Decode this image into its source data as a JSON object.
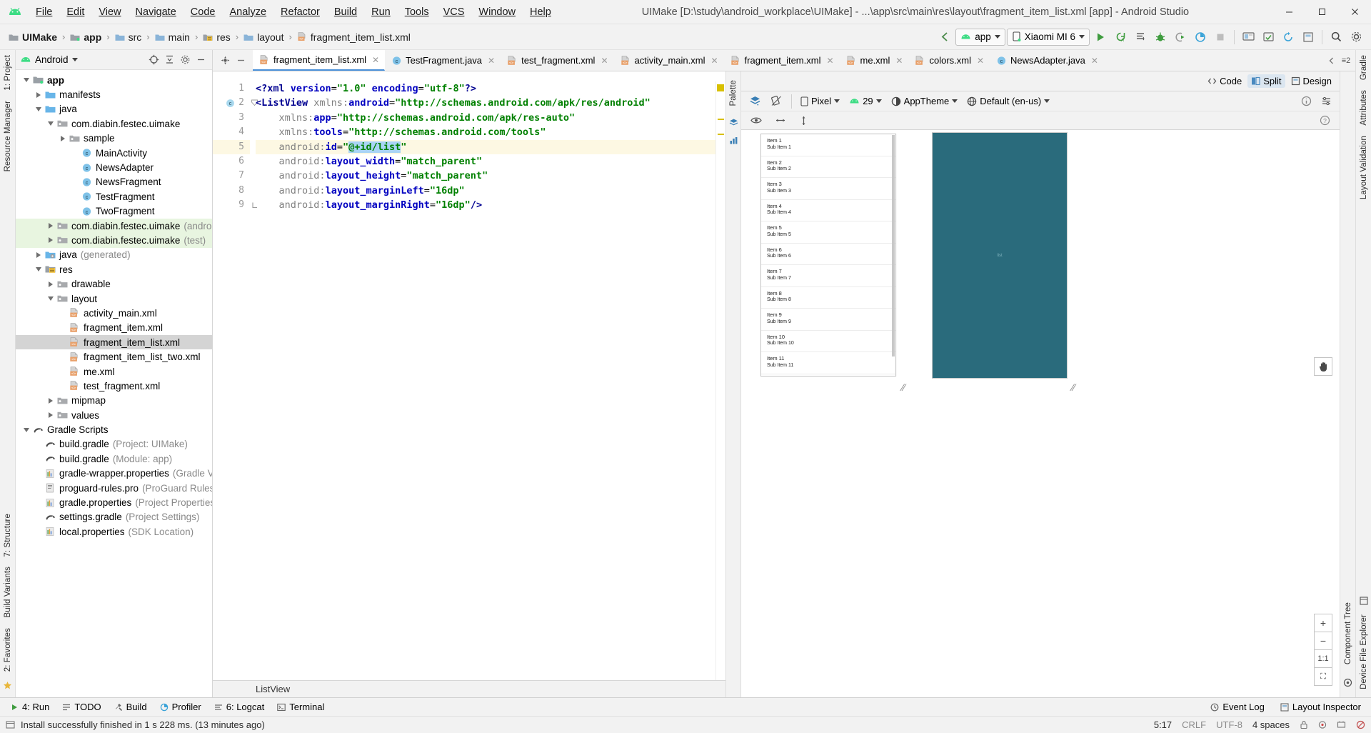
{
  "window": {
    "title": "UIMake [D:\\study\\android_workplace\\UIMake] - ...\\app\\src\\main\\res\\layout\\fragment_item_list.xml [app] - Android Studio",
    "minimize": "–",
    "maximize": "❐",
    "close": "✕"
  },
  "menu": [
    {
      "label": "File"
    },
    {
      "label": "Edit"
    },
    {
      "label": "View"
    },
    {
      "label": "Navigate"
    },
    {
      "label": "Code"
    },
    {
      "label": "Analyze"
    },
    {
      "label": "Refactor"
    },
    {
      "label": "Build"
    },
    {
      "label": "Run"
    },
    {
      "label": "Tools"
    },
    {
      "label": "VCS"
    },
    {
      "label": "Window"
    },
    {
      "label": "Help"
    }
  ],
  "breadcrumb": [
    {
      "label": "UIMake",
      "icon": "project-folder-icon"
    },
    {
      "label": "app",
      "icon": "module-folder-icon"
    },
    {
      "label": "src",
      "icon": "folder-icon"
    },
    {
      "label": "main",
      "icon": "folder-icon"
    },
    {
      "label": "res",
      "icon": "res-folder-icon"
    },
    {
      "label": "layout",
      "icon": "folder-icon"
    },
    {
      "label": "fragment_item_list.xml",
      "icon": "xml-file-icon"
    }
  ],
  "toolbar": {
    "run_config": "app",
    "device": "Xiaomi MI 6",
    "icons": [
      "back-arrow-icon",
      "run-icon",
      "apply-changes-icon",
      "apply-code-changes-icon",
      "debug-icon",
      "attach-debugger-icon",
      "profiler-icon",
      "stop-icon",
      "avd-manager-icon",
      "sdk-manager-icon",
      "sync-gradle-icon",
      "layout-inspector-icon",
      "search-icon"
    ]
  },
  "project_panel": {
    "view_selector": "Android",
    "header_icons": [
      "target-icon",
      "collapse-all-icon",
      "settings-gear-icon",
      "hide-icon"
    ],
    "tree": [
      {
        "label": "app",
        "indent": 0,
        "arrow": "open",
        "icon": "module-icon",
        "bold": true
      },
      {
        "label": "manifests",
        "indent": 1,
        "arrow": "closed",
        "icon": "folder-icon"
      },
      {
        "label": "java",
        "indent": 1,
        "arrow": "open",
        "icon": "folder-icon"
      },
      {
        "label": "com.diabin.festec.uimake",
        "indent": 2,
        "arrow": "open",
        "icon": "package-icon"
      },
      {
        "label": "sample",
        "indent": 3,
        "arrow": "closed",
        "icon": "package-icon"
      },
      {
        "label": "MainActivity",
        "indent": 4,
        "arrow": "none",
        "icon": "java-class-icon"
      },
      {
        "label": "NewsAdapter",
        "indent": 4,
        "arrow": "none",
        "icon": "java-class-icon"
      },
      {
        "label": "NewsFragment",
        "indent": 4,
        "arrow": "none",
        "icon": "java-class-icon"
      },
      {
        "label": "TestFragment",
        "indent": 4,
        "arrow": "none",
        "icon": "java-class-icon"
      },
      {
        "label": "TwoFragment",
        "indent": 4,
        "arrow": "none",
        "icon": "java-class-icon"
      },
      {
        "label": "com.diabin.festec.uimake",
        "sub": "(androidTest)",
        "indent": 2,
        "arrow": "closed",
        "icon": "package-icon",
        "green": true
      },
      {
        "label": "com.diabin.festec.uimake",
        "sub": "(test)",
        "indent": 2,
        "arrow": "closed",
        "icon": "package-icon",
        "green": true
      },
      {
        "label": "java",
        "sub": "(generated)",
        "indent": 1,
        "arrow": "closed",
        "icon": "generated-folder-icon"
      },
      {
        "label": "res",
        "indent": 1,
        "arrow": "open",
        "icon": "res-folder-icon"
      },
      {
        "label": "drawable",
        "indent": 2,
        "arrow": "closed",
        "icon": "package-icon"
      },
      {
        "label": "layout",
        "indent": 2,
        "arrow": "open",
        "icon": "package-icon"
      },
      {
        "label": "activity_main.xml",
        "indent": 3,
        "arrow": "none",
        "icon": "xml-file-icon"
      },
      {
        "label": "fragment_item.xml",
        "indent": 3,
        "arrow": "none",
        "icon": "xml-file-icon"
      },
      {
        "label": "fragment_item_list.xml",
        "indent": 3,
        "arrow": "none",
        "icon": "xml-file-icon",
        "selected": true
      },
      {
        "label": "fragment_item_list_two.xml",
        "indent": 3,
        "arrow": "none",
        "icon": "xml-file-icon"
      },
      {
        "label": "me.xml",
        "indent": 3,
        "arrow": "none",
        "icon": "xml-file-icon"
      },
      {
        "label": "test_fragment.xml",
        "indent": 3,
        "arrow": "none",
        "icon": "xml-file-icon"
      },
      {
        "label": "mipmap",
        "indent": 2,
        "arrow": "closed",
        "icon": "package-icon"
      },
      {
        "label": "values",
        "indent": 2,
        "arrow": "closed",
        "icon": "package-icon"
      },
      {
        "label": "Gradle Scripts",
        "indent": 0,
        "arrow": "open",
        "icon": "gradle-icon"
      },
      {
        "label": "build.gradle",
        "sub": "(Project: UIMake)",
        "indent": 1,
        "arrow": "none",
        "icon": "gradle-icon"
      },
      {
        "label": "build.gradle",
        "sub": "(Module: app)",
        "indent": 1,
        "arrow": "none",
        "icon": "gradle-icon"
      },
      {
        "label": "gradle-wrapper.properties",
        "sub": "(Gradle V",
        "indent": 1,
        "arrow": "none",
        "icon": "properties-icon"
      },
      {
        "label": "proguard-rules.pro",
        "sub": "(ProGuard Rules",
        "indent": 1,
        "arrow": "none",
        "icon": "proguard-icon"
      },
      {
        "label": "gradle.properties",
        "sub": "(Project Properties",
        "indent": 1,
        "arrow": "none",
        "icon": "properties-icon"
      },
      {
        "label": "settings.gradle",
        "sub": "(Project Settings)",
        "indent": 1,
        "arrow": "none",
        "icon": "gradle-icon"
      },
      {
        "label": "local.properties",
        "sub": "(SDK Location)",
        "indent": 1,
        "arrow": "none",
        "icon": "properties-icon"
      }
    ]
  },
  "editor_tabs": [
    {
      "label": "fragment_item_list.xml",
      "icon": "xml-file-icon",
      "active": true
    },
    {
      "label": "TestFragment.java",
      "icon": "java-class-icon",
      "active": false
    },
    {
      "label": "test_fragment.xml",
      "icon": "xml-file-icon",
      "active": false
    },
    {
      "label": "activity_main.xml",
      "icon": "xml-file-icon",
      "active": false
    },
    {
      "label": "fragment_item.xml",
      "icon": "xml-file-icon",
      "active": false
    },
    {
      "label": "me.xml",
      "icon": "xml-file-icon",
      "active": false
    },
    {
      "label": "colors.xml",
      "icon": "xml-file-icon",
      "active": false
    },
    {
      "label": "NewsAdapter.java",
      "icon": "java-class-icon",
      "active": false
    }
  ],
  "editor": {
    "line_count": 9,
    "lines": [
      {
        "n": "1",
        "text": "<?xml version=\"1.0\" encoding=\"utf-8\"?>"
      },
      {
        "n": "2",
        "text": "<ListView xmlns:android=\"http://schemas.android.com/apk/res/android\""
      },
      {
        "n": "3",
        "text": "    xmlns:app=\"http://schemas.android.com/apk/res-auto\""
      },
      {
        "n": "4",
        "text": "    xmlns:tools=\"http://schemas.android.com/tools\""
      },
      {
        "n": "5",
        "text": "    android:id=\"@+id/list\"",
        "highlighted": true
      },
      {
        "n": "6",
        "text": "    android:layout_width=\"match_parent\""
      },
      {
        "n": "7",
        "text": "    android:layout_height=\"match_parent\""
      },
      {
        "n": "8",
        "text": "    android:layout_marginLeft=\"16dp\""
      },
      {
        "n": "9",
        "text": "    android:layout_marginRight=\"16dp\"/>"
      }
    ],
    "selected_text": "@+id/list",
    "bottom_breadcrumb": "ListView"
  },
  "view_modes": [
    {
      "label": "Code",
      "icon": "code-view-icon",
      "active": false
    },
    {
      "label": "Split",
      "icon": "split-view-icon",
      "active": true
    },
    {
      "label": "Design",
      "icon": "design-view-icon",
      "active": false
    }
  ],
  "preview": {
    "toolbar": {
      "layers_label": "",
      "device": "Pixel",
      "api_level": "29",
      "theme": "AppTheme",
      "locale": "Default (en-us)",
      "warning_icon": "warning-info-icon",
      "settings_icon": "settings-icon"
    },
    "toolbar2": {
      "eye_icon": "eye-icon",
      "hmargin_icon": "horizontal-constraint-icon",
      "vmargin_icon": "vertical-constraint-icon",
      "help_icon": "help-icon"
    },
    "list_items": [
      {
        "title": "Item 1",
        "sub": "Sub Item 1"
      },
      {
        "title": "Item 2",
        "sub": "Sub Item 2"
      },
      {
        "title": "Item 3",
        "sub": "Sub Item 3"
      },
      {
        "title": "Item 4",
        "sub": "Sub Item 4"
      },
      {
        "title": "Item 5",
        "sub": "Sub Item 5"
      },
      {
        "title": "Item 6",
        "sub": "Sub Item 6"
      },
      {
        "title": "Item 7",
        "sub": "Sub Item 7"
      },
      {
        "title": "Item 8",
        "sub": "Sub Item 8"
      },
      {
        "title": "Item 9",
        "sub": "Sub Item 9"
      },
      {
        "title": "Item 10",
        "sub": "Sub Item 10"
      },
      {
        "title": "Item 11",
        "sub": "Sub Item 11"
      }
    ],
    "blueprint_label": "list",
    "zoom_buttons": [
      {
        "label": "+",
        "name": "zoom-in-button"
      },
      {
        "label": "−",
        "name": "zoom-out-button"
      },
      {
        "label": "1:1",
        "name": "zoom-actual-size-button"
      },
      {
        "label": "⛶",
        "name": "zoom-fit-button"
      }
    ],
    "pan_button": "✋"
  },
  "rails": {
    "left_top": "1: Project",
    "left_mid": "Resource Manager",
    "left_bottom1": "7: Structure",
    "left_bottom2": "Build Variants",
    "left_bottom3": "2: Favorites",
    "palette": "Palette",
    "component_tree": "Component Tree",
    "right_top": "Gradle",
    "right_mid": "Attributes",
    "right_mid2": "Layout Validation",
    "right_bottom": "Device File Explorer"
  },
  "tool_windows": [
    {
      "label": "4: Run",
      "icon": "run-icon"
    },
    {
      "label": "TODO",
      "icon": "todo-icon"
    },
    {
      "label": "Build",
      "icon": "build-icon"
    },
    {
      "label": "Profiler",
      "icon": "profiler-icon"
    },
    {
      "label": "6: Logcat",
      "icon": "logcat-icon"
    },
    {
      "label": "Terminal",
      "icon": "terminal-icon"
    }
  ],
  "tool_windows_right": [
    {
      "label": "Event Log",
      "icon": "event-log-icon"
    },
    {
      "label": "Layout Inspector",
      "icon": "layout-inspector-icon"
    }
  ],
  "statusbar": {
    "message": "Install successfully finished in 1 s 228 ms. (13 minutes ago)",
    "caret_position": "5:17",
    "line_separator": "CRLF",
    "encoding": "UTF-8",
    "indent": "4 spaces",
    "icons": [
      "lock-icon",
      "event-icon",
      "memory-icon",
      "gitignore-icon"
    ]
  },
  "colors": {
    "accent_blue": "#4a90d9",
    "android_green": "#3ddc84",
    "tab_icon_orange": "#e8a06a",
    "blueprint": "#2a6b7c",
    "highlight_line": "#fdf8e3",
    "selection": "#a9d4f5",
    "string_green": "#008000",
    "tag_blue": "#000091",
    "tree_selected": "#d4d4d4",
    "tree_green": "#e8f5e0",
    "warn_yellow": "#d8c000"
  }
}
